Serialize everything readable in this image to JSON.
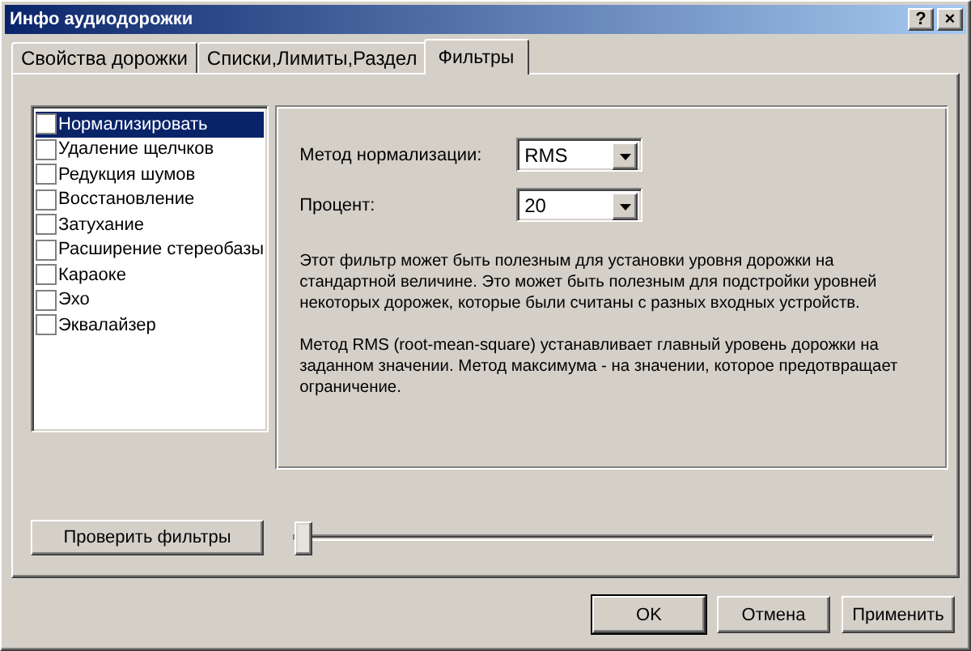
{
  "window": {
    "title": "Инфо аудиодорожки",
    "controls": [
      "?",
      "×"
    ]
  },
  "tabs": [
    {
      "label": "Свойства дорожки",
      "selected": false
    },
    {
      "label": "Списки,Лимиты,Раздел",
      "selected": false
    },
    {
      "label": "Фильтры",
      "selected": true
    }
  ],
  "filters": [
    {
      "label": "Нормализировать",
      "checked": false,
      "selected": true
    },
    {
      "label": "Удаление щелчков",
      "checked": false,
      "selected": false
    },
    {
      "label": "Редукция шумов",
      "checked": false,
      "selected": false
    },
    {
      "label": "Восстановление",
      "checked": false,
      "selected": false
    },
    {
      "label": "Затухание",
      "checked": false,
      "selected": false
    },
    {
      "label": "Расширение стереобазы",
      "checked": false,
      "selected": false
    },
    {
      "label": "Караоке",
      "checked": false,
      "selected": false
    },
    {
      "label": "Эхо",
      "checked": false,
      "selected": false
    },
    {
      "label": "Эквалайзер",
      "checked": false,
      "selected": false
    }
  ],
  "settings": [
    {
      "label": "Метод нормализации:",
      "value": "RMS"
    },
    {
      "label": "Процент:",
      "value": "20"
    }
  ],
  "description": [
    "Этот фильтр может быть полезным для установки уровня дорожки на стандартной величине. Это может быть полезным для подстройки уровней некоторых дорожек, которые были считаны с разных входных устройств.",
    "Метод RMS (root-mean-square) устанавливает главный уровень дорожки на заданном значении. Метод максимума - на значении, которое предотвращает ограничение."
  ],
  "test_button": "Проверить фильтры",
  "preview_slider": {
    "level": 0
  },
  "buttons": [
    {
      "label": "OK",
      "default": true
    },
    {
      "label": "Отмена",
      "default": false
    },
    {
      "label": "Применить",
      "default": false
    }
  ]
}
